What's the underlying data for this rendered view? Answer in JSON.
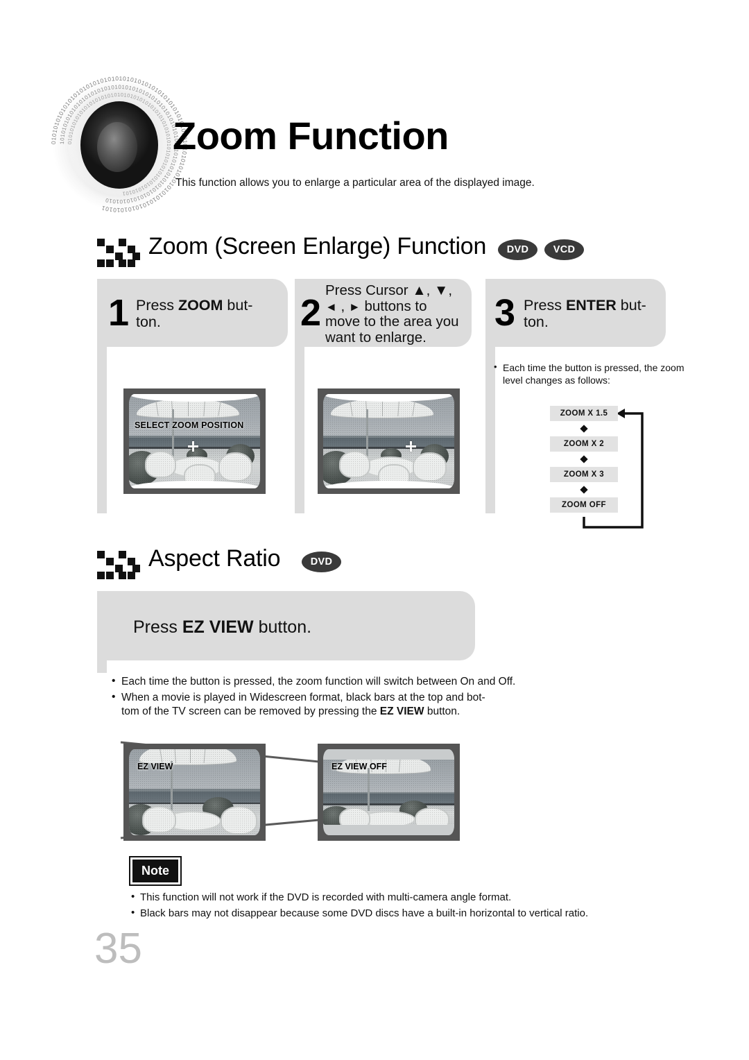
{
  "header": {
    "title": "Zoom Function",
    "subtitle": "This function allows you to enlarge a particular area of the displayed image.",
    "speaker_icon": "speaker-binary-ring-icon"
  },
  "section_zoom": {
    "icon": "checker-arrows-icon",
    "title": "Zoom (Screen Enlarge) Function",
    "badges": [
      "DVD",
      "VCD"
    ],
    "steps": [
      {
        "number": "1",
        "text_parts": [
          {
            "t": "Press ",
            "bold": false
          },
          {
            "t": "ZOOM",
            "bold": true
          },
          {
            "t": " but-­ton.",
            "bold": false
          }
        ],
        "text": "Press ZOOM button.",
        "screen": {
          "osd_text": "SELECT ZOOM POSITION",
          "crosshair": "center"
        }
      },
      {
        "number": "2",
        "text": "Press Cursor ▲, ▼, ◄ , ► buttons to move to the area you want to enlarge.",
        "screen": {
          "osd_text": "",
          "crosshair": "right-of-center"
        }
      },
      {
        "number": "3",
        "text_parts": [
          {
            "t": "Press ",
            "bold": false
          },
          {
            "t": "ENTER",
            "bold": true
          },
          {
            "t": " but-­ton.",
            "bold": false
          }
        ],
        "text": "Press ENTER button.",
        "note_bullet": "Each time the button is pressed, the zoom level changes as follows:"
      }
    ],
    "zoom_flow": [
      "ZOOM X 1.5",
      "ZOOM X 2",
      "ZOOM X 3",
      "ZOOM  OFF"
    ]
  },
  "section_aspect": {
    "icon": "checker-arrows-icon",
    "title": "Aspect Ratio",
    "badges": [
      "DVD"
    ],
    "instruction_plain": "Press EZ VIEW button.",
    "bullets": [
      "Each time the button is pressed, the zoom function will switch between On and Off.",
      "When a movie is played in Widescreen format, black bars at the top and bottom of the TV screen can be removed by pressing the EZ VIEW button."
    ],
    "screens": [
      {
        "label": "EZ VIEW"
      },
      {
        "label": "EZ VIEW OFF"
      }
    ]
  },
  "note": {
    "tag": "Note",
    "bullets": [
      "This function will not work if the DVD is recorded with multi-camera angle format.",
      "Black bars may not disappear because some DVD discs have a built-in horizontal to vertical ratio."
    ]
  },
  "footer": {
    "page_number": "35"
  },
  "colors": {
    "box_gray": "#dcdcdc",
    "badge_gray": "#3a3a3a",
    "page_number_gray": "#bdbdbd",
    "flow_cell_gray": "#e2e2e2",
    "tv_bezel": "#555555"
  }
}
